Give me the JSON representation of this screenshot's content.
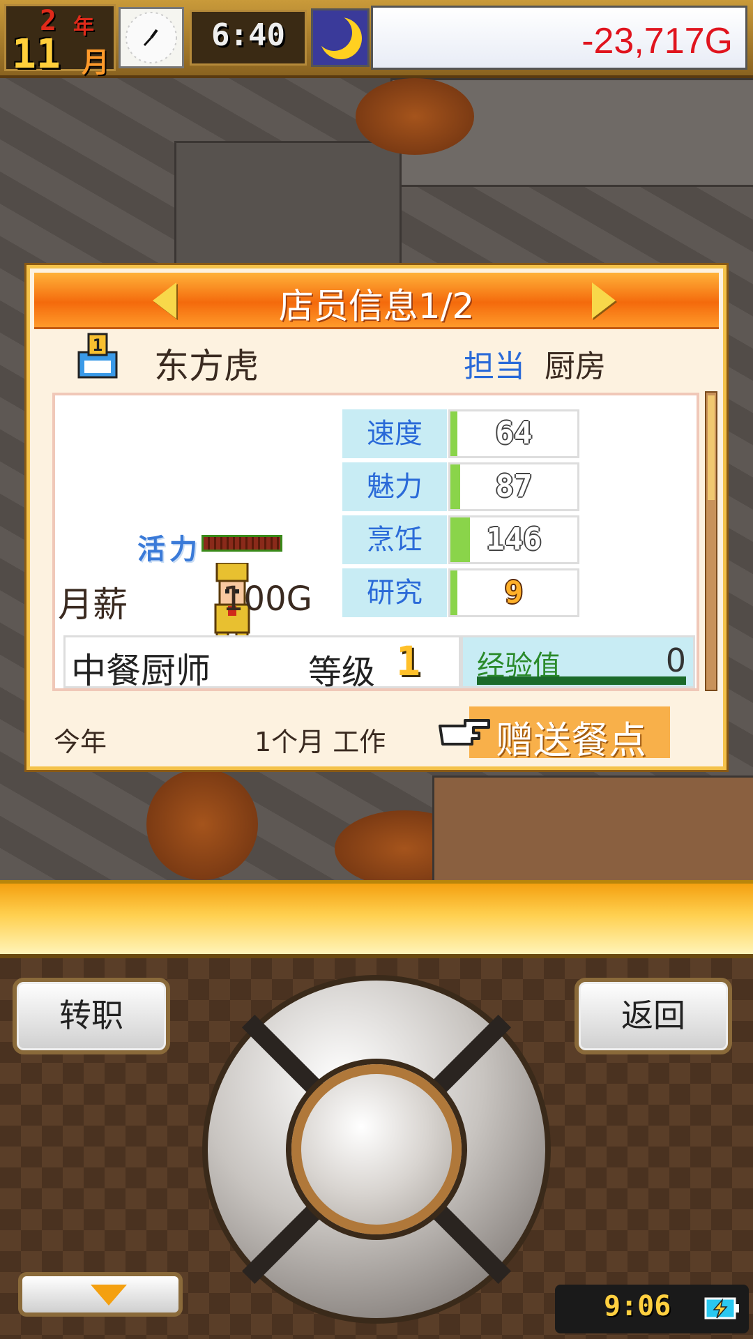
{
  "topbar": {
    "year": "2",
    "year_unit": "年",
    "month": "11",
    "month_unit": "月",
    "time": "6:40",
    "money": "-23,717G"
  },
  "panel": {
    "title": "店员信息1/2",
    "rank": "1",
    "staff_name": "东方虎",
    "assign_label": "担当",
    "assign_value": "厨房",
    "vitality_label": "活力",
    "vitality_level": 1.0,
    "salary_label": "月薪",
    "salary_value": "100G",
    "stats": [
      {
        "label": "速度",
        "value": "64"
      },
      {
        "label": "魅力",
        "value": "87"
      },
      {
        "label": "烹饪",
        "value": "146"
      },
      {
        "label": "研究",
        "value": "9"
      }
    ],
    "job_name": "中餐厨师",
    "level_label": "等级",
    "level_value": "1",
    "exp_label": "经验值",
    "exp_value": "0",
    "this_year": "今年",
    "work_info": "1个月 工作",
    "gift_button": "赠送餐点"
  },
  "controls": {
    "change_job": "转职",
    "back": "返回",
    "system_time": "9:06"
  },
  "colors": {
    "money": "#e0141e",
    "header": "#f46a0c",
    "stat_label_bg": "#c8ecf4",
    "stat_bar": "#8ad44a",
    "gift_button": "#f8b04a"
  },
  "icons": [
    "clock-icon",
    "moon-icon",
    "rank-badge-icon",
    "chef-sprite",
    "pointing-hand-icon",
    "battery-charging-icon",
    "arrow-left-icon",
    "arrow-right-icon",
    "arrow-down-icon"
  ]
}
